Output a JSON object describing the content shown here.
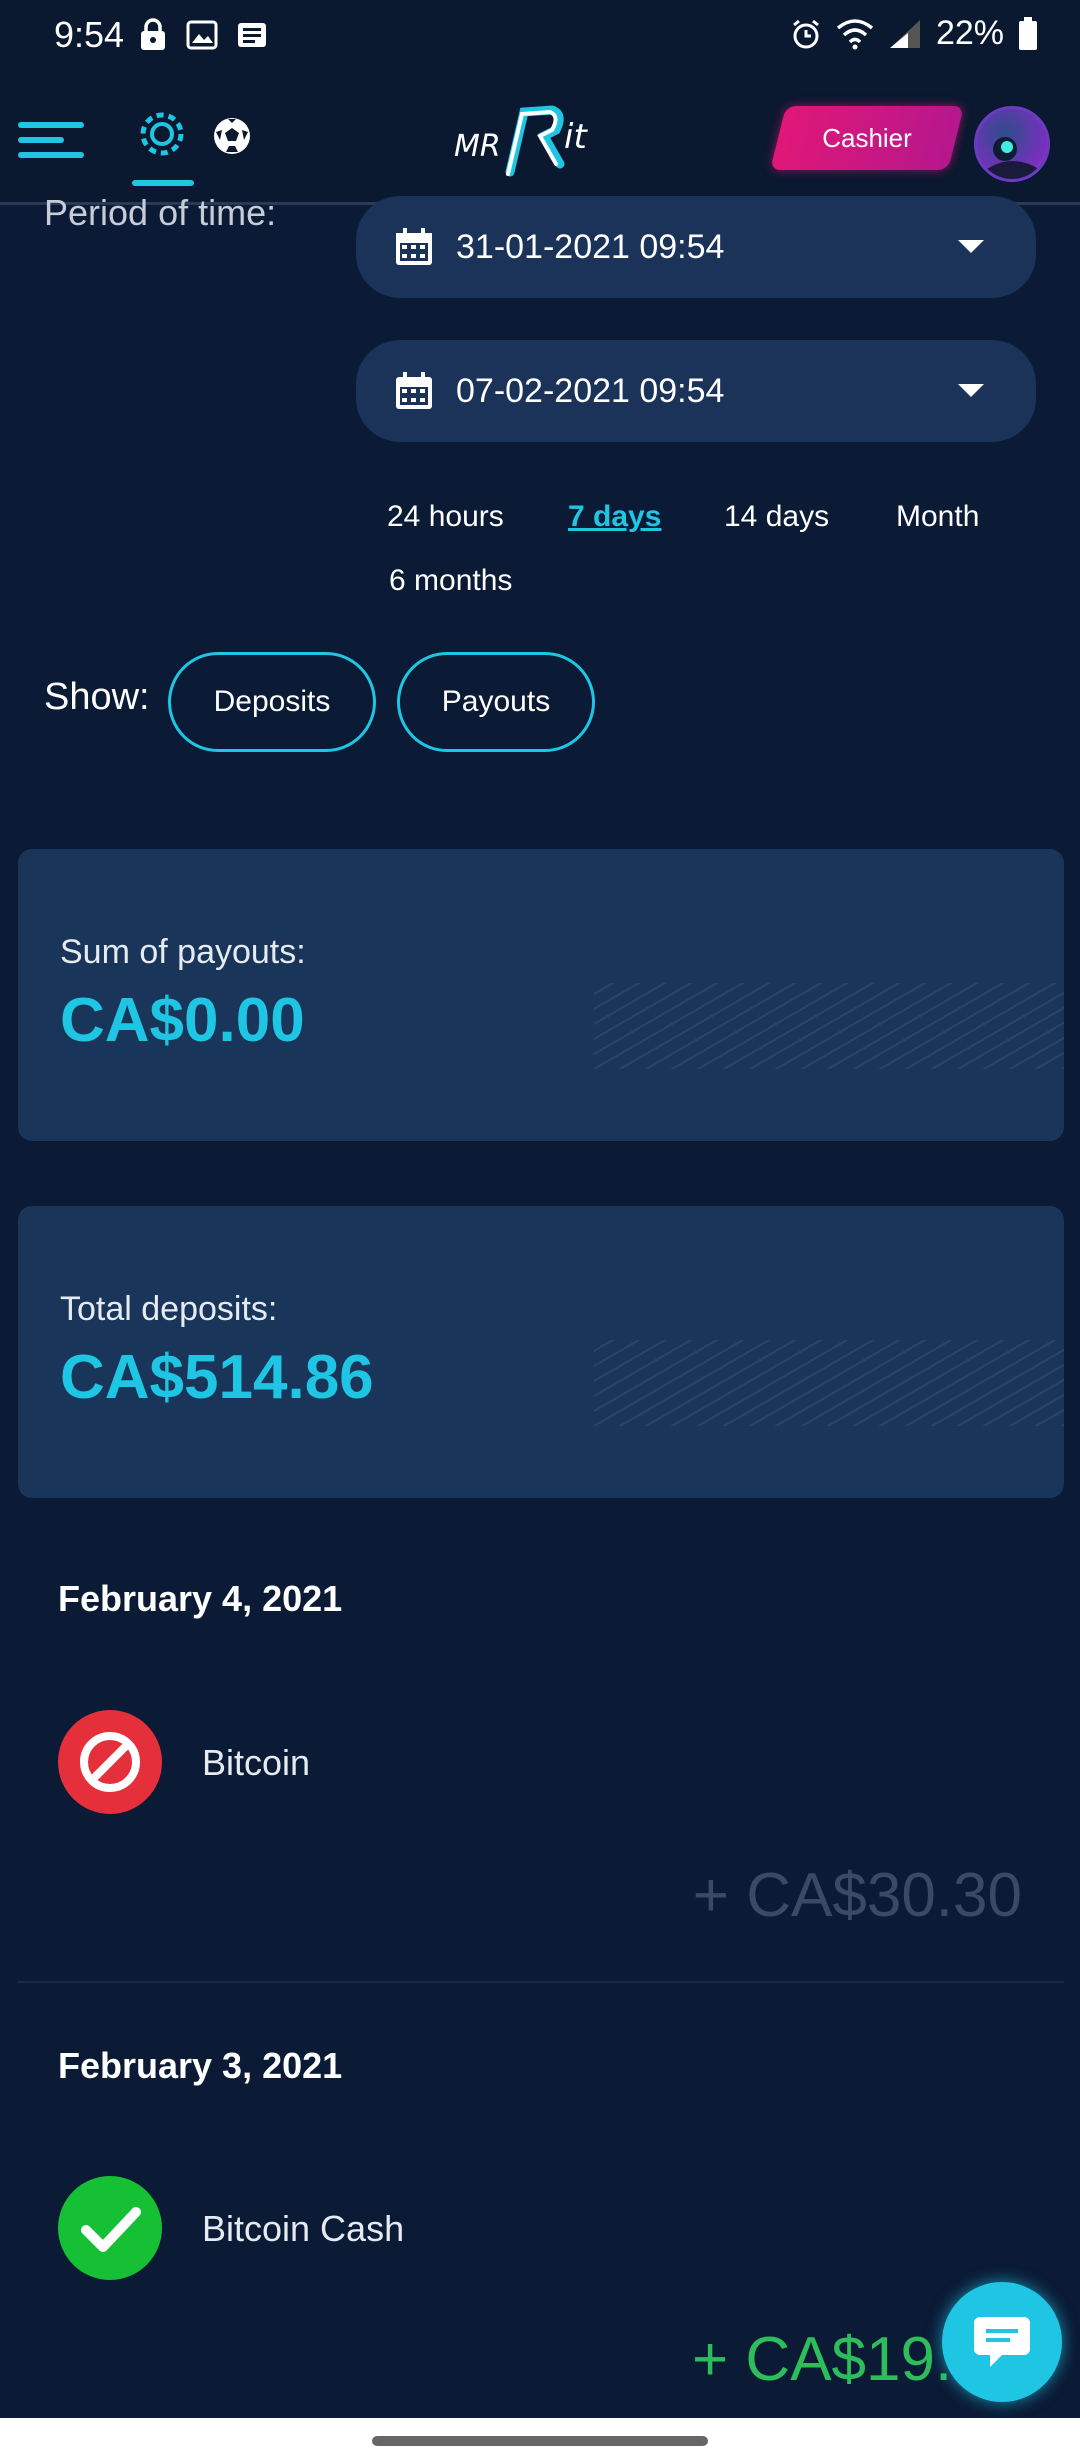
{
  "status_bar": {
    "time": "9:54",
    "battery": "22%"
  },
  "header": {
    "logo_text": "MRBit",
    "cashier_label": "Cashier"
  },
  "filters": {
    "period_label": "Period of time:",
    "date_from": "31-01-2021 09:54",
    "date_to": "07-02-2021 09:54",
    "ranges": [
      "24 hours",
      "7 days",
      "14 days",
      "Month",
      "6 months"
    ],
    "active_range": "7 days",
    "show_label": "Show:",
    "show_options": [
      "Deposits",
      "Payouts"
    ]
  },
  "summary": {
    "payouts_title": "Sum of payouts:",
    "payouts_amount": "CA$0.00",
    "deposits_title": "Total deposits:",
    "deposits_amount": "CA$514.86"
  },
  "transactions": [
    {
      "date": "February 4, 2021",
      "method": "Bitcoin",
      "status": "cancelled",
      "amount": "+ CA$30.30",
      "color": "#3a4a66"
    },
    {
      "date": "February 3, 2021",
      "method": "Bitcoin Cash",
      "status": "success",
      "amount": "+ CA$19.",
      "color": "#2dbd5a"
    }
  ],
  "colors": {
    "accent": "#1ec6e4",
    "background": "#0b1a35",
    "card": "#19355a",
    "cashier": "#e01777",
    "error": "#e5303c",
    "success": "#16c034"
  }
}
